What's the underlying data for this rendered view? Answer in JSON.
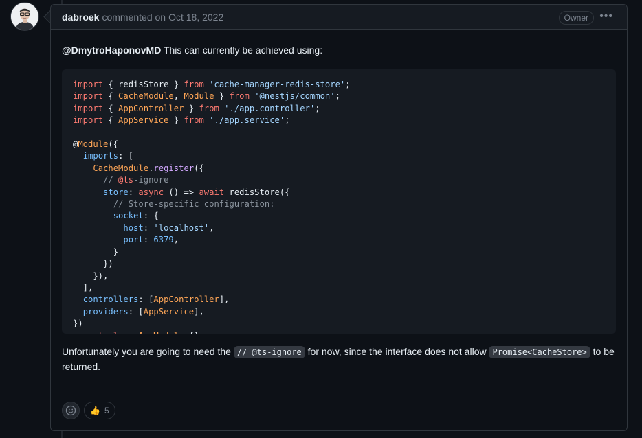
{
  "comment": {
    "author": "dabroek",
    "action_text": "commented on",
    "date": "Oct 18, 2022",
    "role_badge": "Owner",
    "mention": "@DmytroHaponovMD",
    "intro": "This can currently be achieved using:",
    "code_lines": [
      "import { redisStore } from 'cache-manager-redis-store';",
      "import { CacheModule, Module } from '@nestjs/common';",
      "import { AppController } from './app.controller';",
      "import { AppService } from './app.service';",
      "",
      "@Module({",
      "  imports: [",
      "    CacheModule.register({",
      "      // @ts-ignore",
      "      store: async () => await redisStore({",
      "        // Store-specific configuration:",
      "        socket: {",
      "          host: 'localhost',",
      "          port: 6379,",
      "        }",
      "      })",
      "    }),",
      "  ],",
      "  controllers: [AppController],",
      "  providers: [AppService],",
      "})",
      "export class AppModule {}"
    ],
    "outro_part1": "Unfortunately you are going to need the",
    "inline_code1": "// @ts-ignore",
    "outro_part2": "for now, since the interface does not allow",
    "inline_code2": "Promise<CacheStore>",
    "outro_part3": "to be returned."
  },
  "reactions": {
    "add_icon": "smiley-icon",
    "items": [
      {
        "emoji": "👍",
        "icon": "thumbs-up-icon",
        "count": "5"
      }
    ]
  },
  "colors": {
    "background": "#0d1117",
    "header": "#161b22",
    "border": "#30363d",
    "keyword": "#ff7b72",
    "string": "#a5d6ff",
    "entity": "#ffa657",
    "constant": "#79c0ff",
    "comment": "#8b949e"
  }
}
